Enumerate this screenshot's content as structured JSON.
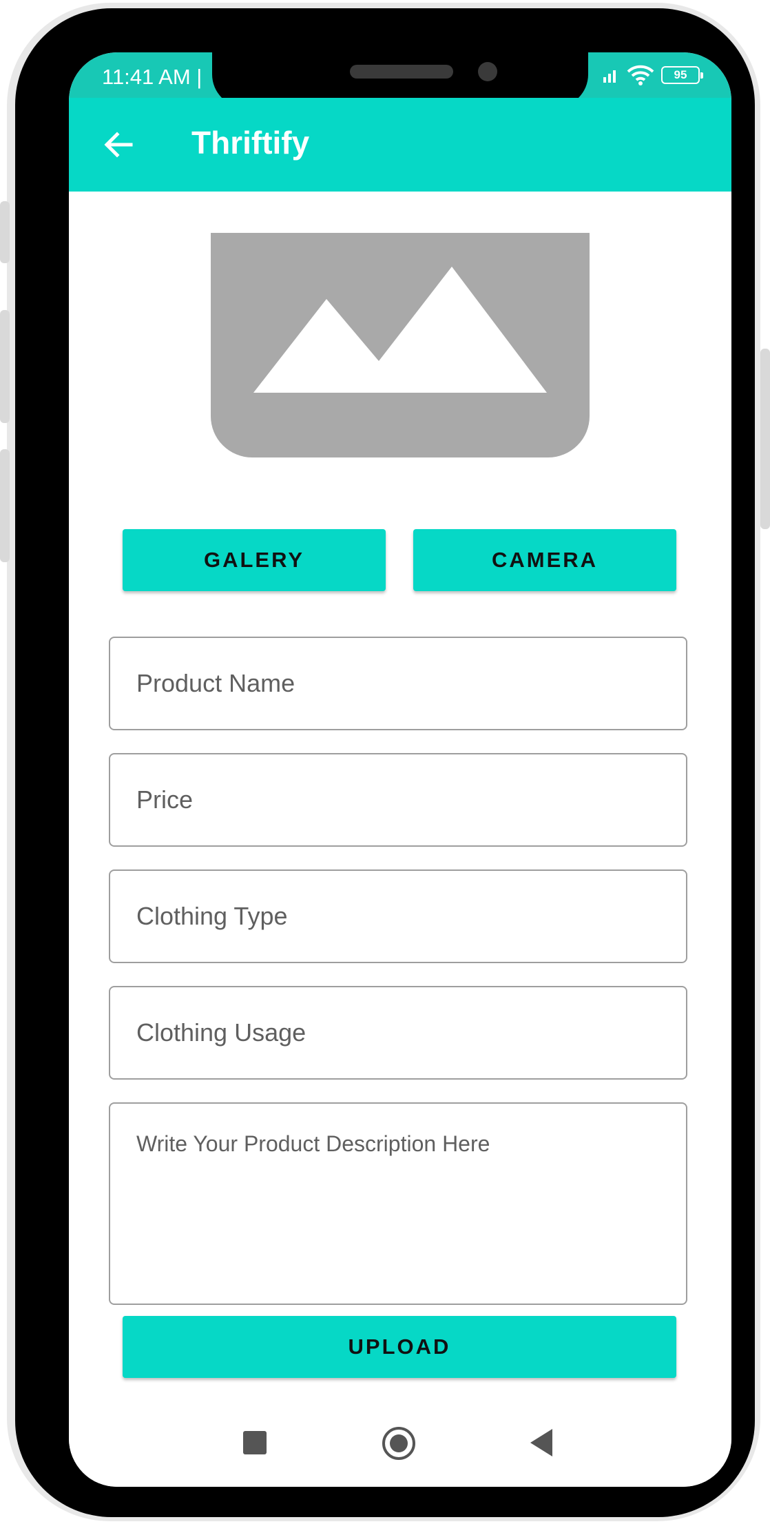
{
  "status_bar": {
    "time": "11:41 AM |",
    "battery": "95"
  },
  "app_bar": {
    "title": "Thriftify"
  },
  "image_picker": {
    "gallery_label": "GALERY",
    "camera_label": "CAMERA"
  },
  "form": {
    "product_name_placeholder": "Product Name",
    "price_placeholder": "Price",
    "clothing_type_placeholder": "Clothing Type",
    "clothing_usage_placeholder": "Clothing Usage",
    "description_placeholder": "Write Your Product Description Here"
  },
  "upload_label": "UPLOAD",
  "colors": {
    "accent": "#06d8c6",
    "status_bar": "#18c8b5",
    "placeholder_image": "#a9a9a9"
  },
  "icons": [
    "back-arrow-icon",
    "image-placeholder-icon",
    "recents-square-icon",
    "home-circle-icon",
    "back-triangle-icon",
    "wifi-icon",
    "signal-icon",
    "battery-icon"
  ]
}
